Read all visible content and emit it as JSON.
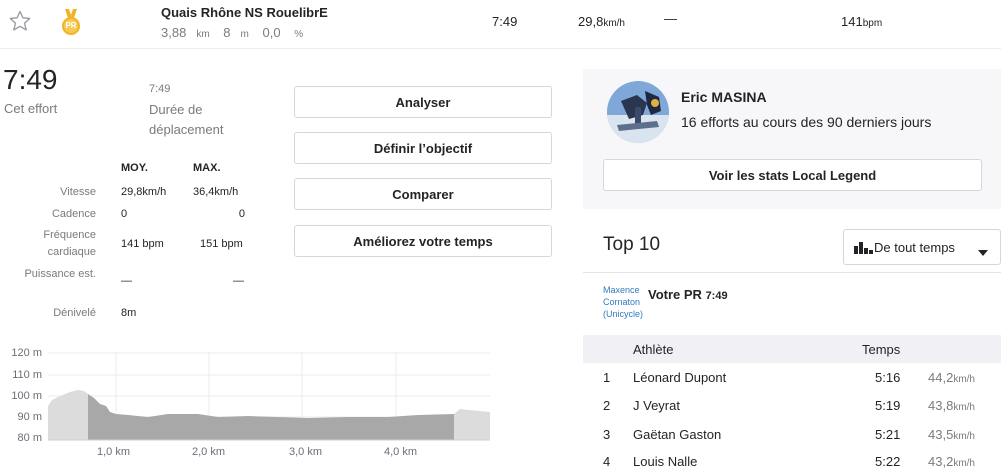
{
  "segment": {
    "name": "Quais Rhône NS RouelibrE",
    "distance": "3,88",
    "distance_unit": "km",
    "elevation": "8",
    "elevation_unit": "m",
    "grade": "0,0",
    "grade_unit": "%",
    "pr_badge": "PR",
    "time": "7:49",
    "speed": "29,8",
    "speed_unit": "km/h",
    "power": "—",
    "heart_rate": "141",
    "heart_rate_unit": "bpm"
  },
  "effort": {
    "time": "7:49",
    "time_label": "Cet effort",
    "moving_time": "7:49",
    "moving_label": "Durée de déplacement"
  },
  "stats_table": {
    "col_avg": "MOY.",
    "col_max": "MAX.",
    "rows": [
      {
        "label": "Vitesse",
        "avg": "29,8km/h",
        "max": "36,4km/h"
      },
      {
        "label": "Cadence",
        "avg": "0",
        "max": "0"
      },
      {
        "label": "Fréquence cardiaque",
        "avg": "141 bpm",
        "max": "151 bpm"
      },
      {
        "label": "Puissance est.",
        "avg": "—",
        "max": "—"
      },
      {
        "label": "Dénivelé",
        "avg": "8m",
        "max": ""
      }
    ]
  },
  "actions": {
    "analyze": "Analyser",
    "set_goal": "Définir l’objectif",
    "compare": "Comparer",
    "improve": "Améliorez votre temps"
  },
  "elevation_chart": {
    "y_ticks": [
      "120 m",
      "110 m",
      "100 m",
      "90 m",
      "80 m"
    ],
    "x_ticks": [
      "1,0 km",
      "2,0 km",
      "3,0 km",
      "4,0 km"
    ]
  },
  "local_legend": {
    "name": "Eric MASINA",
    "subtitle": "16 efforts au cours des 90 derniers jours",
    "button": "Voir les stats Local Legend"
  },
  "leaderboard": {
    "title": "Top 10",
    "filter": "De tout temps",
    "your_pr_owner": "Maxence Cornaton (Unicycle)",
    "your_pr_label": "Votre PR",
    "your_pr_time": "7:49",
    "col_athlete": "Athlète",
    "col_time": "Temps",
    "rows": [
      {
        "rank": "1",
        "athlete": "Léonard Dupont",
        "time": "5:16",
        "speed": "44,2",
        "unit": "km/h"
      },
      {
        "rank": "2",
        "athlete": "J Veyrat",
        "time": "5:19",
        "speed": "43,8",
        "unit": "km/h"
      },
      {
        "rank": "3",
        "athlete": "Gaëtan Gaston",
        "time": "5:21",
        "speed": "43,5",
        "unit": "km/h"
      },
      {
        "rank": "4",
        "athlete": "Louis Nalle",
        "time": "5:22",
        "speed": "43,2",
        "unit": "km/h"
      }
    ]
  },
  "colors": {
    "pr_gold": "#f0b428",
    "link_blue": "#2f7bbf",
    "profile_gray": "#a8a8a8"
  }
}
